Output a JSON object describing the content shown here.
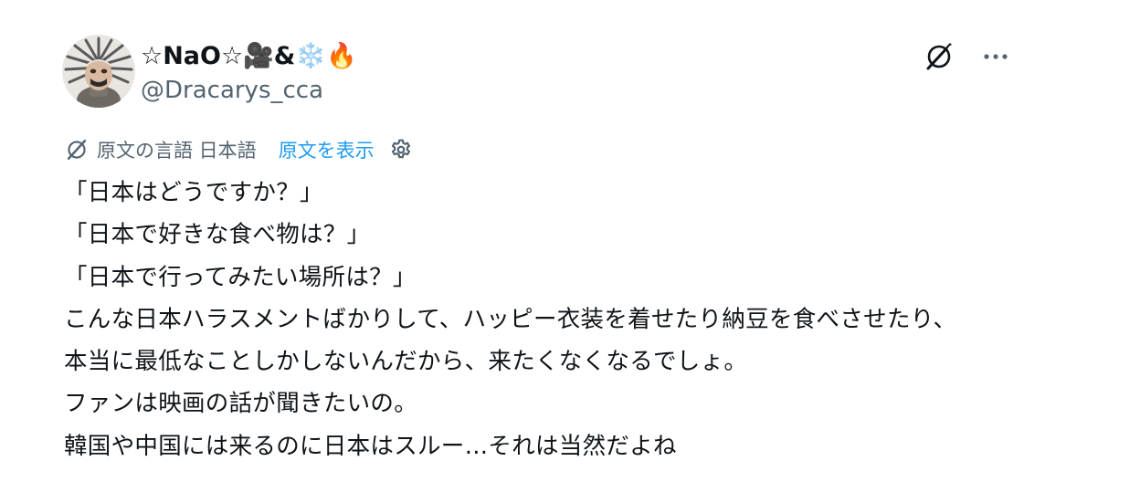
{
  "post": {
    "author": {
      "display_name": "☆NaO☆🎥&❄️🔥",
      "handle": "@Dracarys_cca",
      "avatar_icon": "iron-throne-avatar"
    },
    "header_actions": {
      "grok_icon": "grok-slash-circle-icon",
      "more_icon": "more-dots-icon"
    },
    "translation": {
      "label": "原文の言語 日本語",
      "show_original": "原文を表示",
      "settings_icon": "gear-icon"
    },
    "lines": [
      "「日本はどうですか？」",
      "「日本で好きな食べ物は？」",
      "「日本で行ってみたい場所は？」",
      "こんな日本ハラスメントばかりして、ハッピー衣装を着せたり納豆を食べさせたり、",
      "本当に最低なことしかしないんだから、来たくなくなるでしょ。",
      "ファンは映画の話が聞きたいの。",
      "韓国や中国には来るのに日本はスルー…それは当然だよね"
    ]
  },
  "colors": {
    "text_primary": "#0f1419",
    "text_secondary": "#536471",
    "link": "#1d9bf0"
  }
}
